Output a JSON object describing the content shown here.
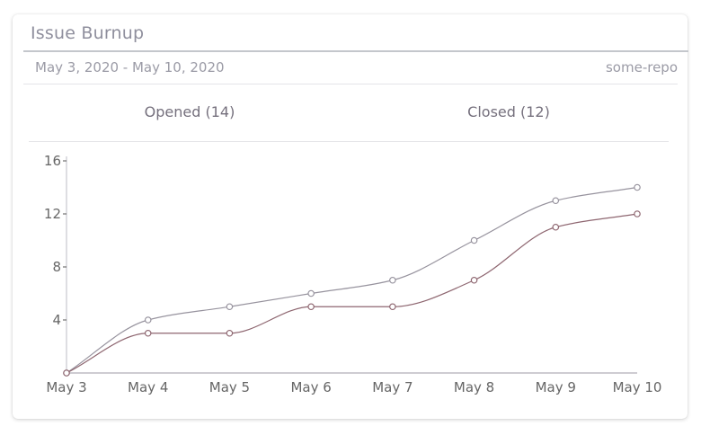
{
  "card": {
    "title": "Issue Burnup",
    "date_range": "May 3, 2020 - May 10, 2020",
    "repo": "some-repo"
  },
  "totals": {
    "opened": "Opened (14)",
    "closed": "Closed (12)"
  },
  "colors": {
    "opened": "#97939e",
    "closed": "#8e6670",
    "axis": "#bdbcc4",
    "text": "#8f8f9d"
  },
  "chart_data": {
    "type": "line",
    "categories": [
      "May 3",
      "May 4",
      "May 5",
      "May 6",
      "May 7",
      "May 8",
      "May 9",
      "May 10"
    ],
    "y_ticks": [
      "16",
      "12",
      "8",
      "4"
    ],
    "ylim": [
      0,
      16
    ],
    "grid": false,
    "series": [
      {
        "key": "opened",
        "values": [
          0,
          4,
          5,
          6,
          7,
          10,
          13,
          14
        ]
      },
      {
        "key": "closed",
        "values": [
          0,
          3,
          3,
          5,
          5,
          7,
          11,
          12
        ]
      }
    ]
  }
}
